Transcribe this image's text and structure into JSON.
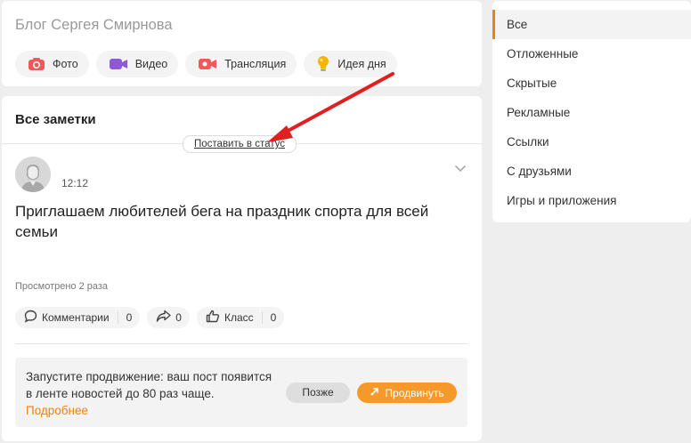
{
  "composer": {
    "title": "Блог Сергея Смирнова",
    "chips": [
      {
        "label": "Фото",
        "icon": "camera-icon",
        "color": "#ee5a5a"
      },
      {
        "label": "Видео",
        "icon": "video-icon",
        "color": "#8e58d6"
      },
      {
        "label": "Трансляция",
        "icon": "stream-icon",
        "color": "#ee5a5a"
      },
      {
        "label": "Идея дня",
        "icon": "lightbulb-icon",
        "color": "#f5b400"
      }
    ]
  },
  "feed": {
    "title": "Все заметки",
    "status_button": "Поставить в статус",
    "post": {
      "time": "12:12",
      "text": "Приглашаем любителей бега на праздник спорта для всей семьи",
      "views": "Просмотрено 2 раза",
      "actions": {
        "comments_label": "Комментарии",
        "comments_count": "0",
        "shares_count": "0",
        "likes_label": "Класс",
        "likes_count": "0"
      }
    },
    "promo": {
      "text": "Запустите продвижение: ваш пост появится в ленте новостей до 80 раз чаще.",
      "link": "Подробнее",
      "later_button": "Позже",
      "promote_button": "Продвинуть"
    }
  },
  "filters": {
    "items": [
      "Все",
      "Отложенные",
      "Скрытые",
      "Рекламные",
      "Ссылки",
      "С друзьями",
      "Игры и приложения"
    ],
    "active_index": 0
  },
  "colors": {
    "accent": "#ee8208",
    "promote_button": "#f59a2a",
    "arrow": "#e02020"
  }
}
